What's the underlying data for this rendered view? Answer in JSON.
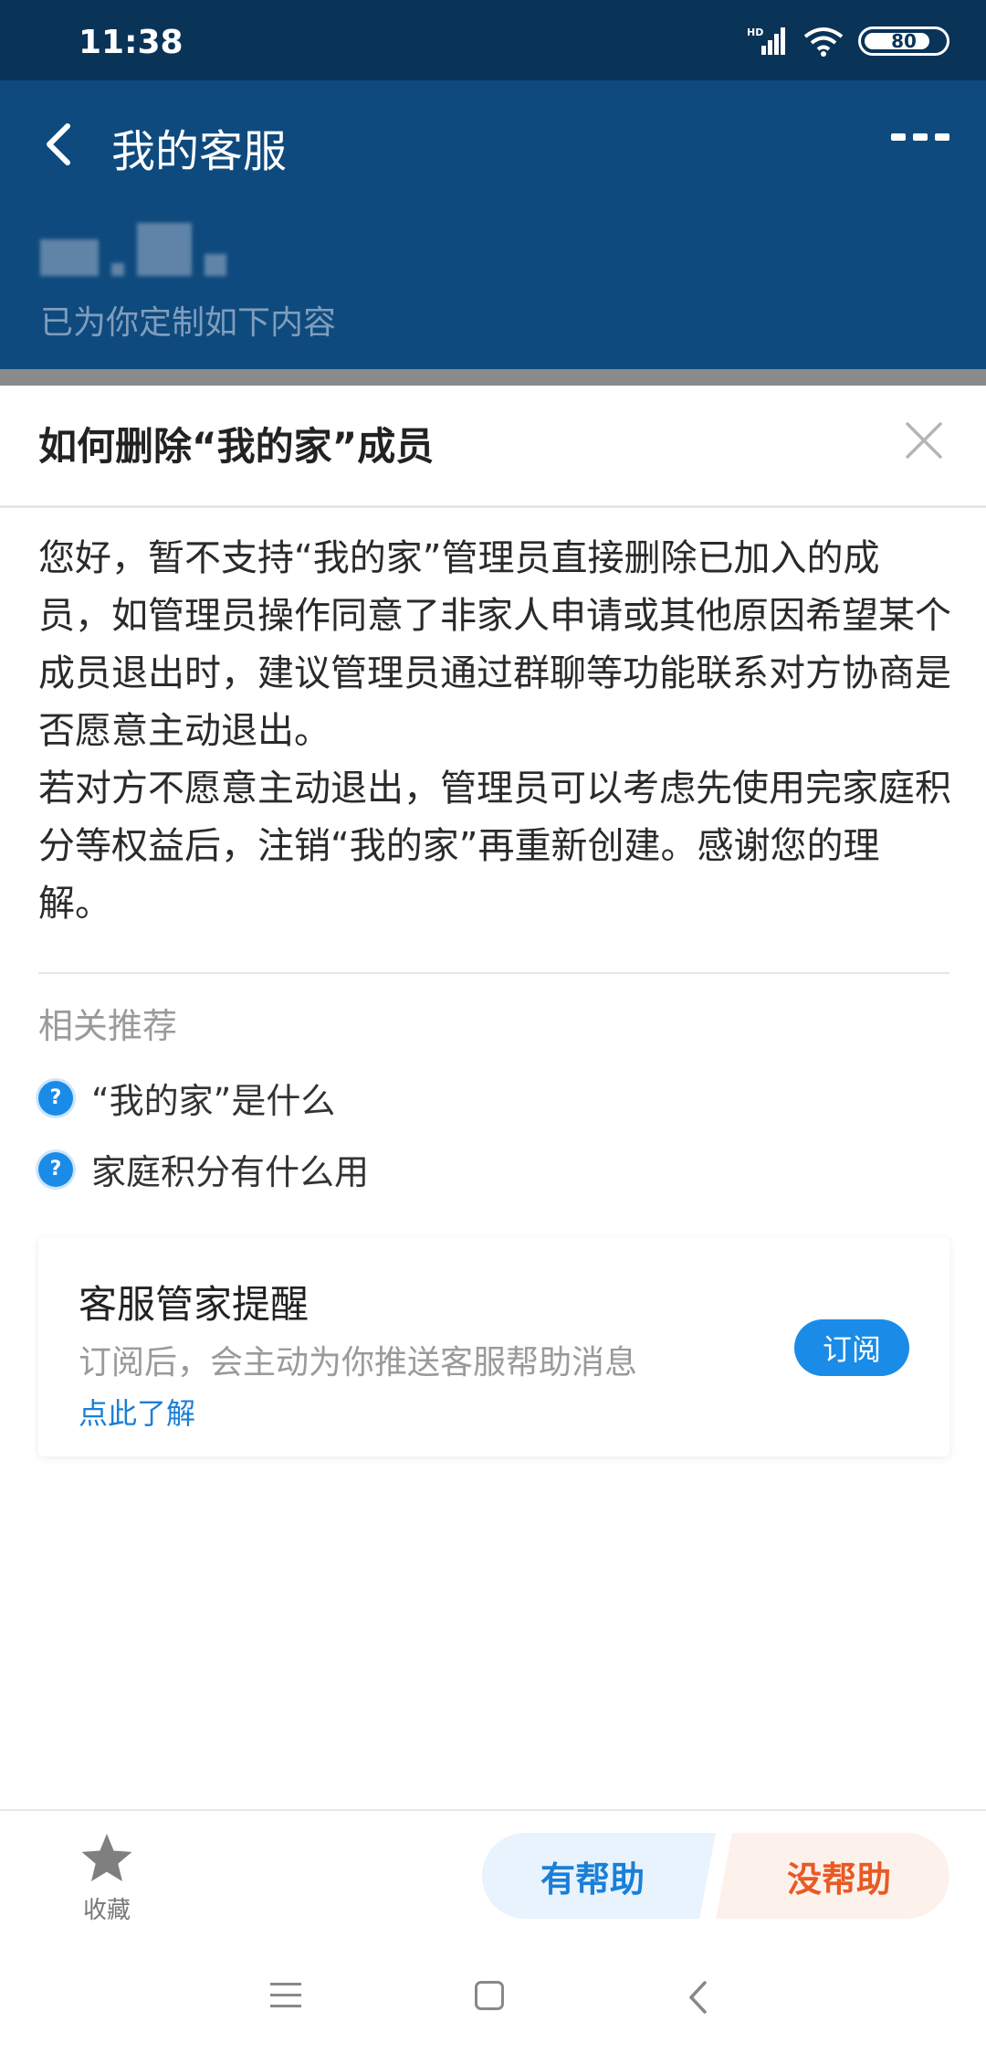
{
  "status_bar": {
    "time": "11:38",
    "battery": "80",
    "network": "HD"
  },
  "header": {
    "title": "我的客服",
    "subtitle": "已为你定制如下内容"
  },
  "panel": {
    "title": "如何删除“我的家”成员",
    "answer_paragraphs": [
      "您好，暂不支持“我的家”管理员直接删除已加入的成员，如管理员操作同意了非家人申请或其他原因希望某个成员退出时，建议管理员通过群聊等功能联系对方协商是否愿意主动退出。",
      "若对方不愿意主动退出，管理员可以考虑先使用完家庭积分等权益后，注销“我的家”再重新创建。感谢您的理解。"
    ]
  },
  "related": {
    "title": "相关推荐",
    "items": [
      {
        "label": "“我的家”是什么"
      },
      {
        "label": "家庭积分有什么用"
      }
    ]
  },
  "reminder_card": {
    "title": "客服管家提醒",
    "description": "订阅后，会主动为你推送客服帮助消息",
    "link": "点此了解",
    "button": "订阅"
  },
  "bottom_bar": {
    "favorite_label": "收藏",
    "helpful_label": "有帮助",
    "unhelpful_label": "没帮助"
  },
  "colors": {
    "header_bg": "#0f4a7e",
    "accent": "#1a8ce8",
    "helpful": "#1a7fd6",
    "unhelpful": "#e85a24"
  }
}
